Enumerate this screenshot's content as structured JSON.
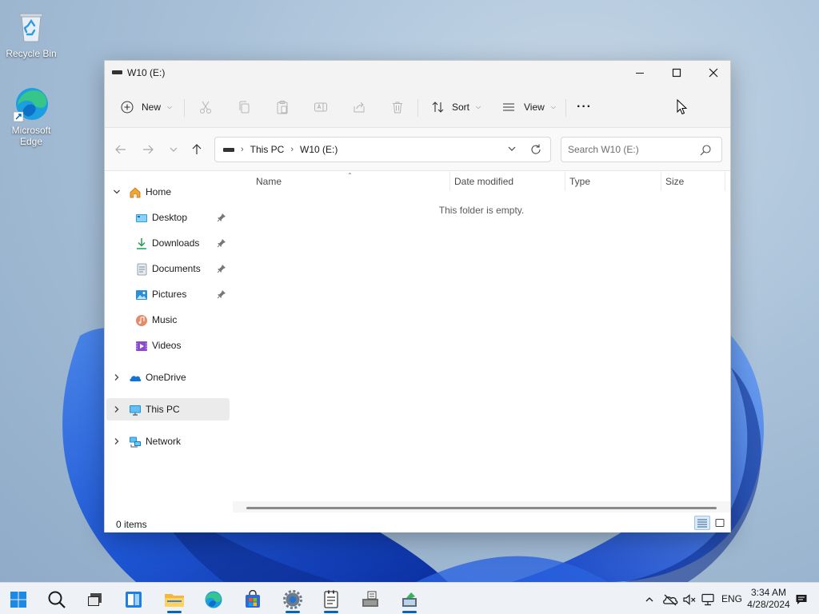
{
  "desktop": {
    "icons": [
      {
        "label": "Recycle Bin"
      },
      {
        "label": "Microsoft Edge"
      }
    ]
  },
  "window": {
    "title": "W10 (E:)",
    "controls": {
      "minimize": "minimize-icon",
      "maximize": "maximize-icon",
      "close": "close-icon"
    }
  },
  "toolbar": {
    "new_label": "New",
    "sort_label": "Sort",
    "view_label": "View",
    "more_label": "···",
    "actions": [
      "cut",
      "copy",
      "paste",
      "rename",
      "share",
      "delete"
    ]
  },
  "address": {
    "crumbs": [
      "This PC",
      "W10 (E:)"
    ],
    "search_placeholder": "Search W10 (E:)"
  },
  "sidebar": {
    "items": [
      {
        "label": "Home",
        "icon": "home-icon",
        "expanded": true
      },
      {
        "label": "Desktop",
        "icon": "desktop-folder-icon",
        "pinned": true
      },
      {
        "label": "Downloads",
        "icon": "downloads-icon",
        "pinned": true
      },
      {
        "label": "Documents",
        "icon": "documents-icon",
        "pinned": true
      },
      {
        "label": "Pictures",
        "icon": "pictures-icon",
        "pinned": true
      },
      {
        "label": "Music",
        "icon": "music-icon"
      },
      {
        "label": "Videos",
        "icon": "videos-icon"
      },
      {
        "label": "OneDrive",
        "icon": "onedrive-icon",
        "expanded": false
      },
      {
        "label": "This PC",
        "icon": "this-pc-icon",
        "expanded": false,
        "selected": true
      },
      {
        "label": "Network",
        "icon": "network-icon",
        "expanded": false
      }
    ]
  },
  "content": {
    "columns": [
      "Name",
      "Date modified",
      "Type",
      "Size"
    ],
    "sorted_column": "Name",
    "empty_message": "This folder is empty."
  },
  "status": {
    "item_count": "0 items"
  },
  "taskbar": {
    "apps": [
      "start",
      "search",
      "task-view",
      "widgets",
      "file-explorer",
      "edge",
      "store",
      "settings",
      "notepad",
      "app-installer",
      "app-extra"
    ],
    "active_apps": [
      "file-explorer",
      "settings",
      "notepad",
      "app-extra"
    ],
    "language": "ENG",
    "time": "3:34 AM",
    "date": "4/28/2024"
  },
  "colors": {
    "accent": "#0067c0",
    "selection": "#ebebeb",
    "taskbar": "#eef1f5"
  }
}
